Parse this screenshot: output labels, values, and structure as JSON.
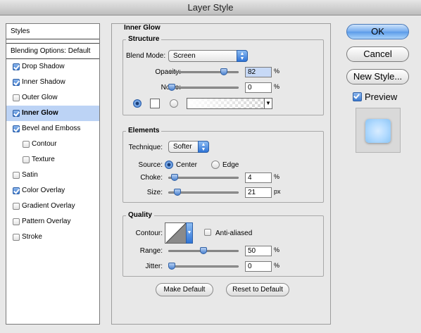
{
  "window": {
    "title": "Layer Style"
  },
  "styles_list": {
    "header": "Styles",
    "blending": "Blending Options: Default",
    "items": [
      {
        "label": "Drop Shadow",
        "checked": true
      },
      {
        "label": "Inner Shadow",
        "checked": true
      },
      {
        "label": "Outer Glow",
        "checked": false
      },
      {
        "label": "Inner Glow",
        "checked": true,
        "selected": true
      },
      {
        "label": "Bevel and Emboss",
        "checked": true
      },
      {
        "label": "Contour",
        "checked": false
      },
      {
        "label": "Texture",
        "checked": false
      },
      {
        "label": "Satin",
        "checked": false
      },
      {
        "label": "Color Overlay",
        "checked": true
      },
      {
        "label": "Gradient Overlay",
        "checked": false
      },
      {
        "label": "Pattern Overlay",
        "checked": false
      },
      {
        "label": "Stroke",
        "checked": false
      }
    ]
  },
  "inner_glow": {
    "title": "Inner Glow",
    "structure": {
      "title": "Structure",
      "blend_mode_label": "Blend Mode:",
      "blend_mode_value": "Screen",
      "opacity_label": "Opacity:",
      "opacity_value": "82",
      "opacity_unit": "%",
      "opacity_fraction": 0.82,
      "noise_label": "Noise:",
      "noise_value": "0",
      "noise_unit": "%",
      "noise_fraction": 0.0
    },
    "elements": {
      "title": "Elements",
      "technique_label": "Technique:",
      "technique_value": "Softer",
      "source_label": "Source:",
      "source_center": "Center",
      "source_edge": "Edge",
      "source_selected": "Center",
      "choke_label": "Choke:",
      "choke_value": "4",
      "choke_unit": "%",
      "choke_fraction": 0.04,
      "size_label": "Size:",
      "size_value": "21",
      "size_unit": "px",
      "size_fraction": 0.084
    },
    "quality": {
      "title": "Quality",
      "contour_label": "Contour:",
      "antialiased_label": "Anti-aliased",
      "antialiased_checked": false,
      "range_label": "Range:",
      "range_value": "50",
      "range_unit": "%",
      "range_fraction": 0.5,
      "jitter_label": "Jitter:",
      "jitter_value": "0",
      "jitter_unit": "%",
      "jitter_fraction": 0.0
    },
    "make_default": "Make Default",
    "reset_default": "Reset to Default"
  },
  "actions": {
    "ok": "OK",
    "cancel": "Cancel",
    "new_style": "New Style...",
    "preview_label": "Preview",
    "preview_checked": true
  }
}
